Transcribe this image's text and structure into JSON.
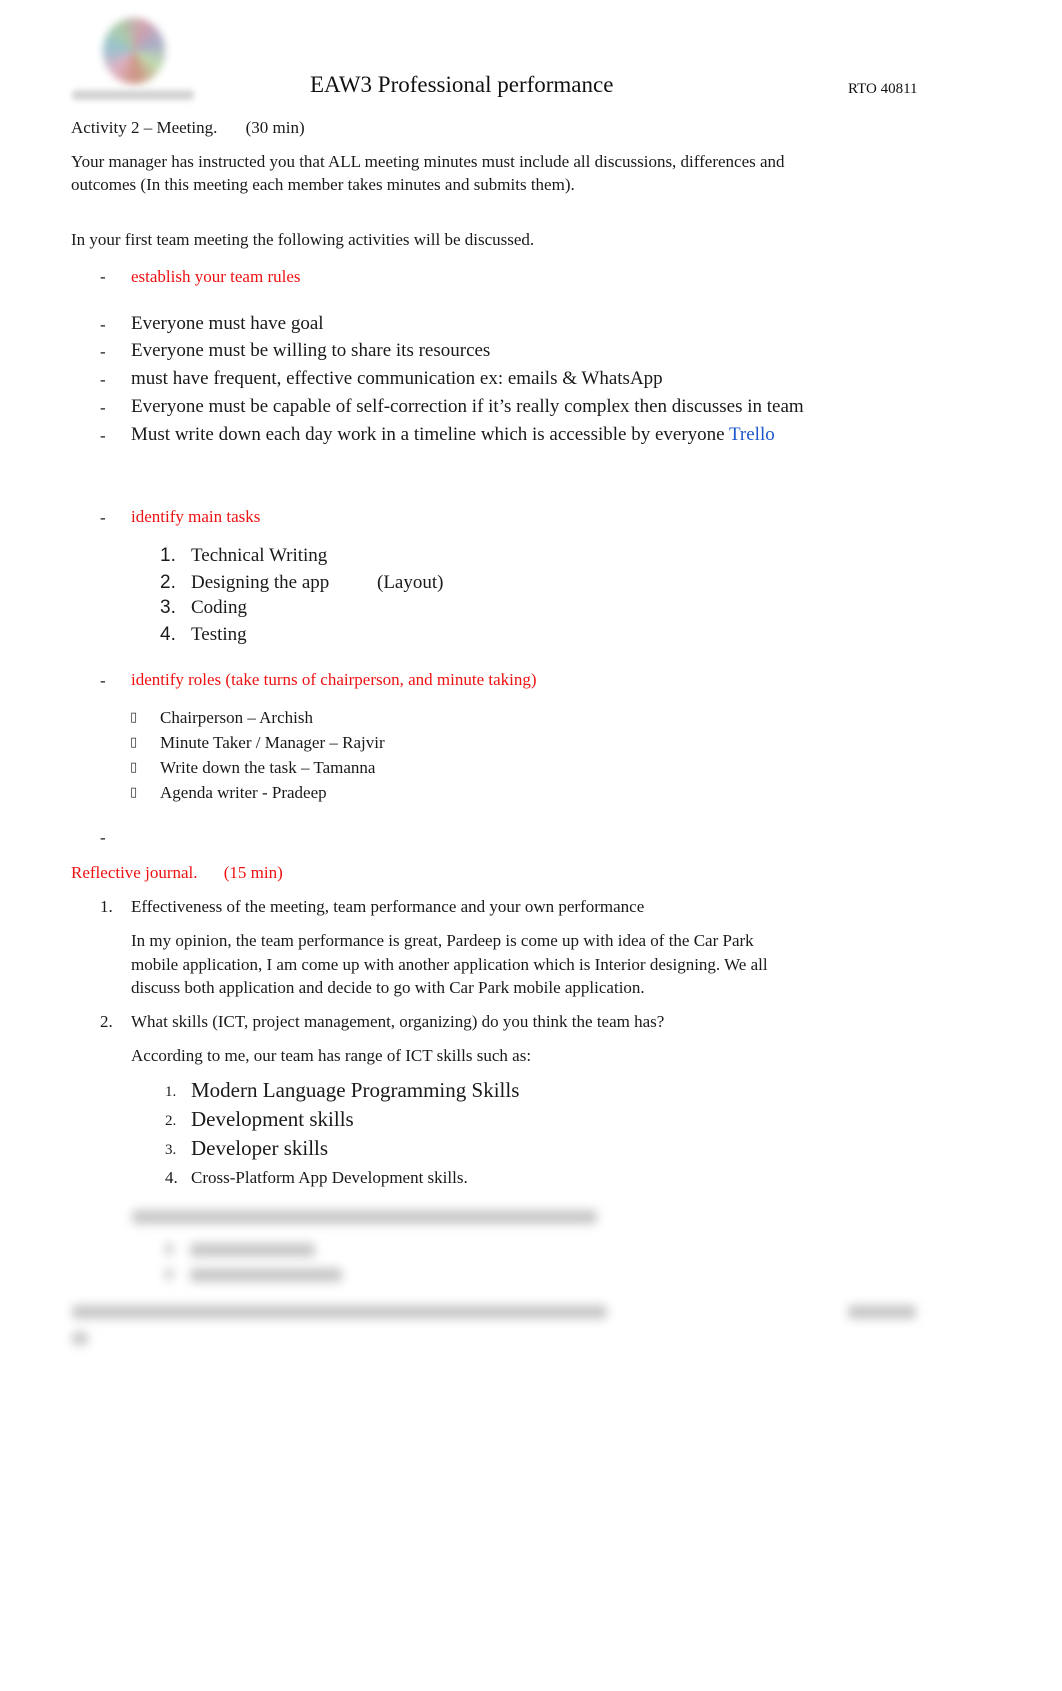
{
  "header": {
    "logo_icon": "organization-globe-logo",
    "title": "EAW3 Professional performance",
    "rto": "RTO 40811"
  },
  "activity": {
    "heading": "Activity 2 – Meeting.",
    "duration": "(30 min)",
    "intro_line1": "Your manager has instructed you that ALL meeting minutes must include all discussions, differences and",
    "intro_line2": "outcomes (In this meeting each member takes minutes and submits them).",
    "first_meeting": "In your first team meeting the following activities will be discussed."
  },
  "team_rules": {
    "heading": "establish your team rules",
    "bullet": "-",
    "items": [
      {
        "text": "Everyone must have goal"
      },
      {
        "text": "Everyone must be willing to share its resources"
      },
      {
        "text": "must have frequent, effective communication ex: emails & WhatsApp"
      },
      {
        "text": "Everyone must be capable of self-correction if it’s really complex then discusses in team"
      },
      {
        "text": "Must write down each day work in a timeline which is accessible by everyone ",
        "link": "Trello"
      }
    ]
  },
  "main_tasks": {
    "heading": "identify main tasks",
    "items": [
      {
        "num": "1.",
        "text": "Technical Writing",
        "note": ""
      },
      {
        "num": "2.",
        "text": "Designing the app",
        "note": "(Layout)"
      },
      {
        "num": "3.",
        "text": "Coding",
        "note": ""
      },
      {
        "num": "4.",
        "text": "Testing",
        "note": ""
      }
    ]
  },
  "roles": {
    "heading": "identify roles (take turns of chairperson, and minute taking)",
    "bullet_glyph": "▯",
    "items": [
      {
        "text": "Chairperson – Archish"
      },
      {
        "text": "Minute Taker / Manager – Rajvir"
      },
      {
        "text": "Write down the task – Tamanna"
      },
      {
        "text": "Agenda writer - Pradeep"
      }
    ],
    "trailing_dash": "-"
  },
  "reflective": {
    "heading": "Reflective journal.",
    "duration": "(15 min)",
    "q1_num": "1.",
    "q1": "Effectiveness of the meeting, team performance and your own performance",
    "a1_line1": "In my opinion, the team performance is great, Pardeep is come up with idea of the Car Park",
    "a1_line2": "mobile application, I am come up with another application which is Interior designing. We all",
    "a1_line3": "discuss both application and decide to go with Car Park mobile application.",
    "q2_num": "2.",
    "q2": "What skills (ICT, project management, organizing) do you think the team has?",
    "a2": "According to me, our team has range of ICT skills such as:",
    "skills": [
      {
        "num": "1.",
        "text": "Modern Language Programming Skills"
      },
      {
        "num": "2.",
        "text": "Development skills"
      },
      {
        "num": "3.",
        "text": "Developer skills"
      },
      {
        "num": "4.",
        "text": "Cross-Platform App Development skills."
      }
    ]
  }
}
